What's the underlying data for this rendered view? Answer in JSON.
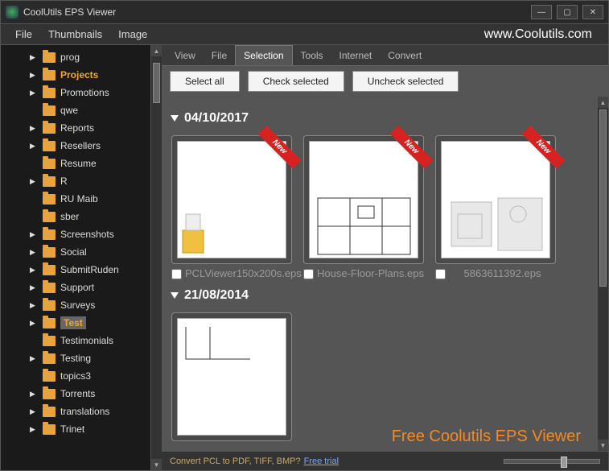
{
  "window": {
    "title": "CoolUtils EPS Viewer"
  },
  "menubar": {
    "items": [
      "File",
      "Thumbnails",
      "Image"
    ],
    "url": "www.Coolutils.com"
  },
  "sidebar": {
    "items": [
      {
        "label": "prog",
        "arrow": true
      },
      {
        "label": "Projects",
        "arrow": true,
        "highlight": true
      },
      {
        "label": "Promotions",
        "arrow": true
      },
      {
        "label": "qwe"
      },
      {
        "label": "Reports",
        "arrow": true
      },
      {
        "label": "Resellers",
        "arrow": true
      },
      {
        "label": "Resume"
      },
      {
        "label": "R",
        "arrow": true
      },
      {
        "label": "RU Maib"
      },
      {
        "label": "sber"
      },
      {
        "label": "Screenshots",
        "arrow": true
      },
      {
        "label": "Social",
        "arrow": true
      },
      {
        "label": "SubmitRuden",
        "arrow": true
      },
      {
        "label": "Support",
        "arrow": true
      },
      {
        "label": "Surveys",
        "arrow": true
      },
      {
        "label": "Test",
        "arrow": true,
        "selected": true
      },
      {
        "label": "Testimonials"
      },
      {
        "label": "Testing",
        "arrow": true
      },
      {
        "label": "topics3"
      },
      {
        "label": "Torrents",
        "arrow": true
      },
      {
        "label": "translations",
        "arrow": true
      },
      {
        "label": "Trinet",
        "arrow": true
      }
    ]
  },
  "tabs": {
    "items": [
      "View",
      "File",
      "Selection",
      "Tools",
      "Internet",
      "Convert"
    ],
    "active": 2
  },
  "toolbar": {
    "select_all": "Select all",
    "check_checked": "Check selected",
    "uncheck_checked": "Uncheck selected"
  },
  "groups": [
    {
      "date": "04/10/2017",
      "files": [
        {
          "name": "PCLViewer150x200s.eps",
          "new": true
        },
        {
          "name": "House-Floor-Plans.eps",
          "new": true
        },
        {
          "name": "5863611392.eps",
          "new": true
        }
      ]
    },
    {
      "date": "21/08/2014",
      "files": [
        {
          "name": "",
          "new": false
        }
      ]
    }
  ],
  "watermark": "Free Coolutils EPS Viewer",
  "statusbar": {
    "text": "Convert PCL to PDF, TIFF, BMP?",
    "link": "Free trial"
  },
  "ribbon_label": "New"
}
